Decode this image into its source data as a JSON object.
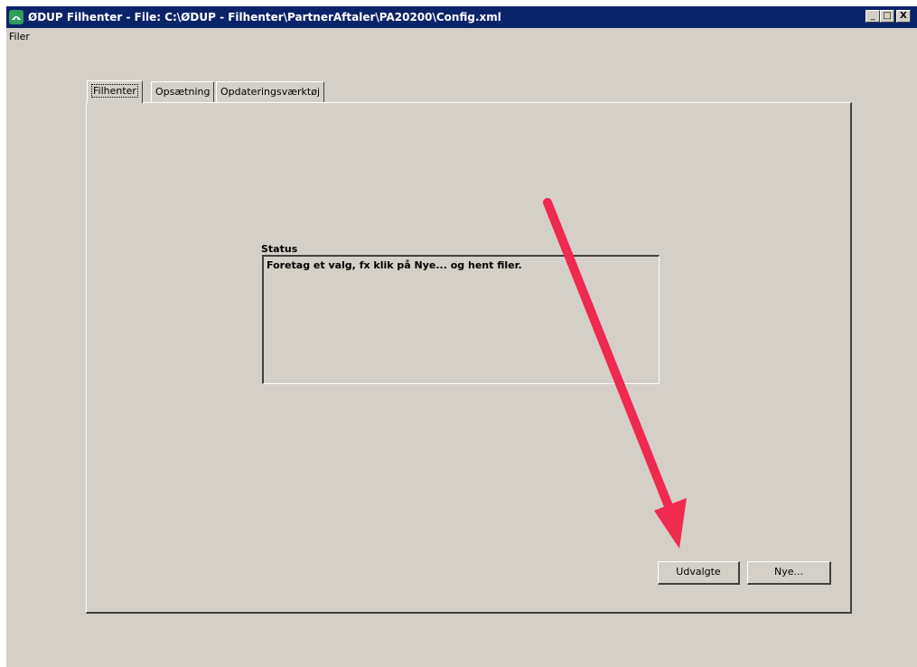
{
  "window": {
    "title": "ØDUP Filhenter - File: C:\\ØDUP - Filhenter\\PartnerAftaler\\PA20200\\Config.xml",
    "controls": {
      "minimize": "_",
      "maximize": "□",
      "close": "X"
    }
  },
  "menu": {
    "items": [
      {
        "label": "Filer"
      }
    ]
  },
  "tabs": [
    {
      "label": "Filhenter",
      "active": true
    },
    {
      "label": "Opsætning",
      "active": false
    },
    {
      "label": "Opdateringsværktøj",
      "active": false
    }
  ],
  "status": {
    "label": "Status",
    "text": "Foretag et valg, fx klik på Nye... og hent filer."
  },
  "buttons": {
    "selected": "Udvalgte",
    "new": "Nye..."
  },
  "annotation": {
    "arrow_color": "#f0294f"
  },
  "colors": {
    "titlebar": "#0a246a",
    "face": "#d4d0c8",
    "app_icon": "#2f9e5a"
  }
}
